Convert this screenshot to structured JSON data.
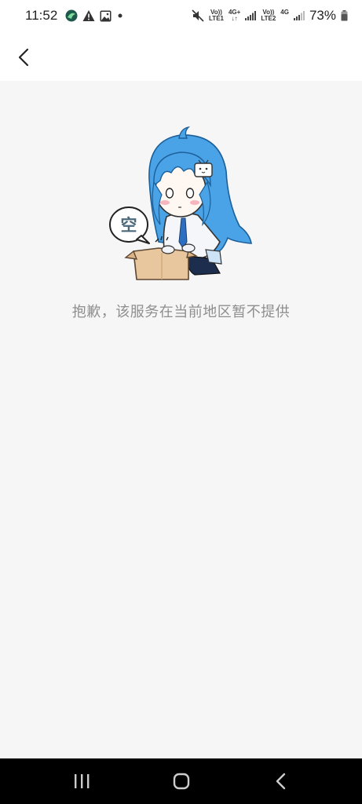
{
  "status_bar": {
    "time": "11:52",
    "network1_top": "Vo))",
    "network1_bottom": "LTE1",
    "network1_type": "4G+",
    "network2_top": "Vo))",
    "network2_bottom": "LTE2",
    "network2_type": "4G",
    "battery": "73%",
    "icons": [
      "app-icon",
      "warning-icon",
      "image-icon",
      "notification-dot-icon",
      "mute-icon",
      "signal-icon",
      "battery-icon"
    ]
  },
  "header": {
    "back_icon": "chevron-left-icon"
  },
  "empty_state": {
    "illustration_bubble_text": "空",
    "message": "抱歉，该服务在当前地区暂不提供"
  },
  "nav_bar": {
    "icons": [
      "recents-icon",
      "home-icon",
      "back-icon"
    ]
  },
  "colors": {
    "background": "#f6f6f6",
    "header": "#ffffff",
    "message_text": "#8e8e8e",
    "character_hair": "#4aa3e6",
    "box": "#e8c79f"
  }
}
